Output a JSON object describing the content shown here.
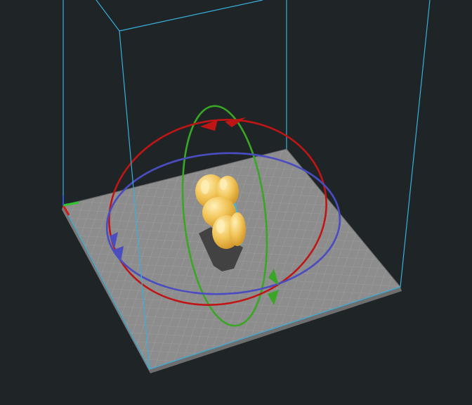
{
  "viewport": {
    "background": "#1f2527",
    "build_volume_color": "#3aaedc",
    "bed_color": "#8d8d8d",
    "bed_grid_color": "#9e9e9e",
    "bed_edge_color": "#6a6a6a"
  },
  "model": {
    "body_color": "#f2c65a",
    "highlight_color": "#fff0b8",
    "outline_color": "#3fb6e0",
    "shadow_color": "#3a3a3a",
    "selected": true
  },
  "rotate_gizmo": {
    "rings": [
      {
        "axis": "x",
        "color": "#3aa626"
      },
      {
        "axis": "y",
        "color": "#c01515"
      },
      {
        "axis": "z",
        "color": "#4a4dc0"
      }
    ]
  },
  "origin_axes": {
    "x_color": "#d21b1b",
    "y_color": "#2ec52e",
    "z_color": "#2c54d6"
  }
}
